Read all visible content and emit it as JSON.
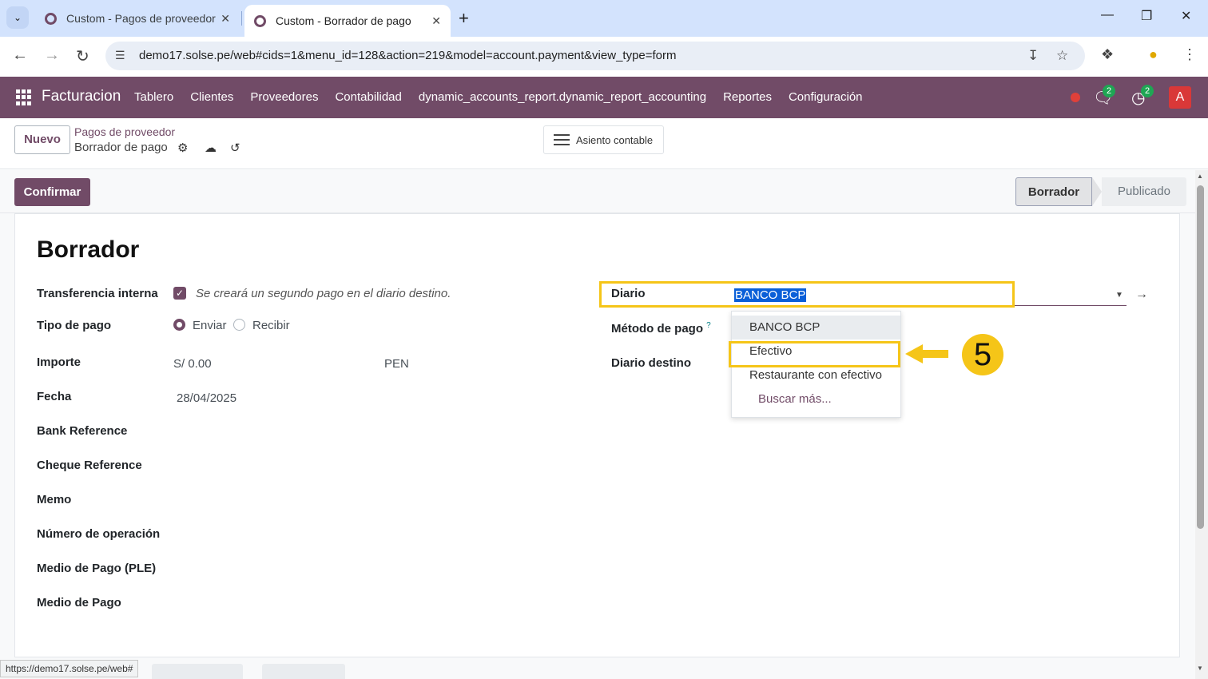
{
  "browser": {
    "tabs": [
      {
        "title": "Custom - Pagos de proveedor",
        "active": false
      },
      {
        "title": "Custom - Borrador de pago",
        "active": true
      }
    ],
    "url": "demo17.solse.pe/web#cids=1&menu_id=128&action=219&model=account.payment&view_type=form",
    "status_url": "https://demo17.solse.pe/web#"
  },
  "navbar": {
    "app_name": "Facturacion",
    "menu": [
      "Tablero",
      "Clientes",
      "Proveedores",
      "Contabilidad",
      "dynamic_accounts_report.dynamic_report_accounting",
      "Reportes",
      "Configuración"
    ],
    "messages_count": "2",
    "activities_count": "2",
    "avatar_letter": "A",
    "colors": {
      "brand": "#714b67",
      "badge": "#1fa654",
      "avatar": "#d93838"
    }
  },
  "control_panel": {
    "new_label": "Nuevo",
    "breadcrumb_parent": "Pagos de proveedor",
    "breadcrumb_current": "Borrador de pago",
    "journal_entry_label": "Asiento contable"
  },
  "statusbar": {
    "confirm_label": "Confirmar",
    "steps": [
      "Borrador",
      "Publicado"
    ],
    "current_step": "Borrador"
  },
  "form": {
    "title": "Borrador",
    "fields": {
      "internal_transfer": {
        "label": "Transferencia interna",
        "checked": true,
        "help": "Se creará un segundo pago en el diario destino."
      },
      "payment_type": {
        "label": "Tipo de pago",
        "options": [
          "Enviar",
          "Recibir"
        ],
        "selected": "Enviar"
      },
      "amount": {
        "label": "Importe",
        "value": "S/ 0.00",
        "currency": "PEN"
      },
      "date": {
        "label": "Fecha",
        "value": "28/04/2025"
      },
      "bank_reference": {
        "label": "Bank Reference"
      },
      "cheque_reference": {
        "label": "Cheque Reference"
      },
      "memo": {
        "label": "Memo"
      },
      "operation_number": {
        "label": "Número de operación"
      },
      "payment_medium_ple": {
        "label": "Medio de Pago (PLE)"
      },
      "payment_medium": {
        "label": "Medio de Pago"
      },
      "journal": {
        "label": "Diario",
        "value": "BANCO BCP"
      },
      "payment_method": {
        "label": "Método de pago",
        "tooltip": "?"
      },
      "destination_journal": {
        "label": "Diario destino"
      }
    },
    "journal_dropdown": {
      "options": [
        "BANCO BCP",
        "Efectivo",
        "Restaurante con efectivo"
      ],
      "search_more": "Buscar más...",
      "highlighted": "BANCO BCP",
      "annotated": "Efectivo"
    }
  },
  "annotation": {
    "step_number": "5",
    "color": "#f5c518"
  }
}
